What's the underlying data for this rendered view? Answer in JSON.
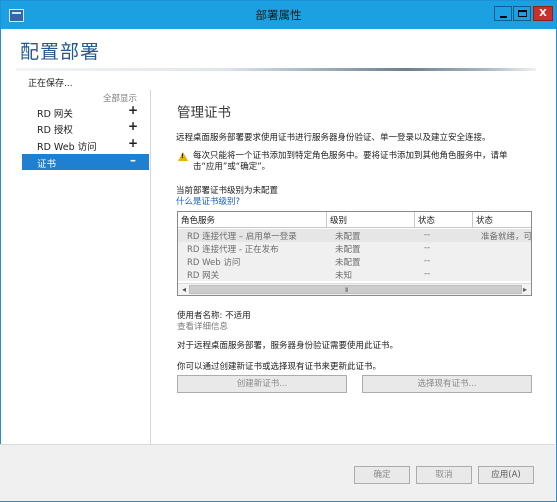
{
  "window": {
    "title": "部署属性"
  },
  "header": {
    "title": "配置部署"
  },
  "sidebar": {
    "section_label": "正在保存...",
    "show_all": "全部显示",
    "items": [
      {
        "label": "RD 网关",
        "sign": "+"
      },
      {
        "label": "RD 授权",
        "sign": "+"
      },
      {
        "label": "RD Web 访问",
        "sign": "+"
      },
      {
        "label": "证书",
        "sign": "–"
      }
    ]
  },
  "main": {
    "heading": "管理证书",
    "description": "远程桌面服务部署要求使用证书进行服务器身份验证、单一登录以及建立安全连接。",
    "warning": "每次只能将一个证书添加到特定角色服务中。要将证书添加到其他角色服务中，请单击“应用”或“确定”。",
    "cert_level_text": "当前部署证书级别为未配置",
    "cert_level_link": "什么是证书级别?",
    "table": {
      "columns": [
        "角色服务",
        "级别",
        "状态",
        "状态"
      ],
      "rows": [
        {
          "role": "RD 连接代理 – 启用单一登录",
          "level": "未配置",
          "state": "--",
          "status": "准备就绪，可"
        },
        {
          "role": "RD 连接代理 - 正在发布",
          "level": "未配置",
          "state": "--",
          "status": ""
        },
        {
          "role": "RD Web 访问",
          "level": "未配置",
          "state": "--",
          "status": ""
        },
        {
          "role": "RD 网关",
          "level": "未知",
          "state": "--",
          "status": ""
        }
      ],
      "scroll_left": "◂",
      "scroll_right": "▸",
      "thumb_grip": "III"
    },
    "user_name": "使用者名称: 不适用",
    "view_details": "查看详细信息",
    "paragraph1": "对于远程桌面服务部署，服务器身份验证需要使用此证书。",
    "paragraph2": "你可以通过创建新证书或选择现有证书来更新此证书。",
    "create_button": "创建新证书...",
    "select_button": "选择现有证书..."
  },
  "footer": {
    "ok": "确定",
    "cancel": "取消",
    "apply": "应用(A)"
  },
  "caption": {
    "close": "X"
  },
  "colors": {
    "titlebar": "#1ba1e2",
    "selection": "#1f7fd0",
    "heading": "#25598f",
    "close": "#c7312b"
  }
}
